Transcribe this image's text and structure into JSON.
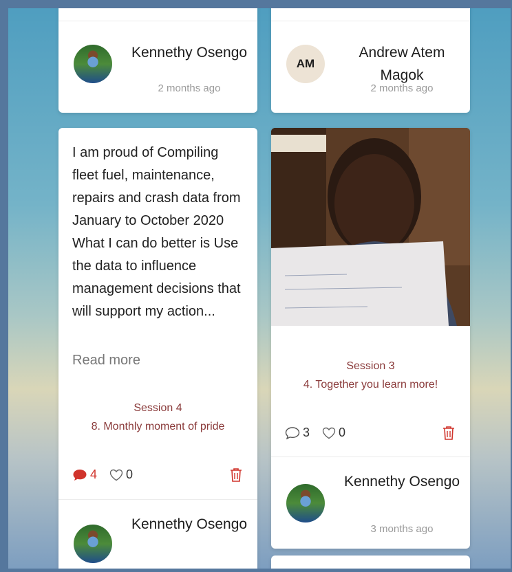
{
  "cards": {
    "top_left": {
      "name": "Kennethy Osengo",
      "time": "2 months ago"
    },
    "top_right": {
      "initials": "AM",
      "name": "Andrew Atem Magok",
      "time": "2 months ago"
    },
    "post_left": {
      "text": "I am proud of Compiling fleet fuel, maintenance, repairs and crash data from January to October 2020 What I can do better is Use the data to influence management decisions that will support my action...",
      "read_more": "Read more",
      "session": "Session 4",
      "activity": "8. Monthly moment of pride",
      "comments": "4",
      "likes": "0",
      "author_name": "Kennethy Osengo"
    },
    "post_right": {
      "session": "Session 3",
      "activity": "4. Together you learn more!",
      "comments": "3",
      "likes": "0",
      "author_name": "Kennethy Osengo",
      "time": "3 months ago"
    }
  },
  "colors": {
    "accent_red": "#d0342c",
    "session_text": "#8a3a3a"
  },
  "icons": [
    "comment-filled-icon",
    "comment-outline-icon",
    "heart-outline-icon",
    "trash-icon"
  ]
}
